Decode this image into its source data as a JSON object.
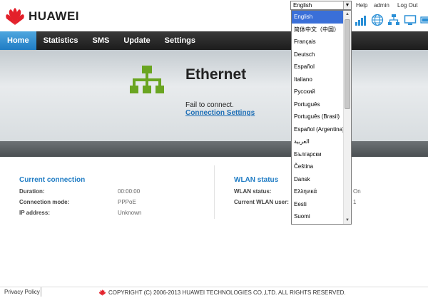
{
  "brand": {
    "name": "HUAWEI"
  },
  "header": {
    "language_selected": "English",
    "links": {
      "help": "Help",
      "admin": "admin",
      "logout": "Log Out"
    },
    "status_icons": [
      "signal-icon",
      "globe-icon",
      "network-icon",
      "monitor-icon",
      "battery-icon"
    ]
  },
  "nav": {
    "items": [
      {
        "label": "Home",
        "active": true
      },
      {
        "label": "Statistics"
      },
      {
        "label": "SMS"
      },
      {
        "label": "Update"
      },
      {
        "label": "Settings"
      }
    ]
  },
  "hero": {
    "title": "Ethernet",
    "status": "Fail to connect.",
    "link": "Connection Settings"
  },
  "current_connection": {
    "title": "Current connection",
    "rows": [
      {
        "label": "Duration:",
        "value": "00:00:00"
      },
      {
        "label": "Connection mode:",
        "value": "PPPoE"
      },
      {
        "label": "IP address:",
        "value": "Unknown"
      }
    ]
  },
  "wlan_status": {
    "title": "WLAN status",
    "rows": [
      {
        "label": "WLAN status:",
        "value": "On"
      },
      {
        "label": "Current WLAN user:",
        "value": "1"
      }
    ]
  },
  "language_dropdown": {
    "options": [
      "English",
      "简体中文（中国）",
      "Français",
      "Deutsch",
      "Español",
      "Italiano",
      "Русский",
      "Português",
      "Português (Brasil)",
      "Español (Argentina)",
      "العربية",
      "Български",
      "Čeština",
      "Dansk",
      "Ελληνικά",
      "Eesti",
      "Suomi"
    ],
    "selected_index": 0
  },
  "footer": {
    "privacy": "Privacy Policy",
    "copyright": "COPYRIGHT (C) 2006-2013 HUAWEI TECHNOLOGIES CO.,LTD. ALL RIGHTS RESERVED."
  },
  "colors": {
    "accent": "#1f7cc4",
    "nav_bg": "#2a2a2a",
    "logo_red": "#e3202a",
    "ethernet_green": "#6aa521"
  }
}
